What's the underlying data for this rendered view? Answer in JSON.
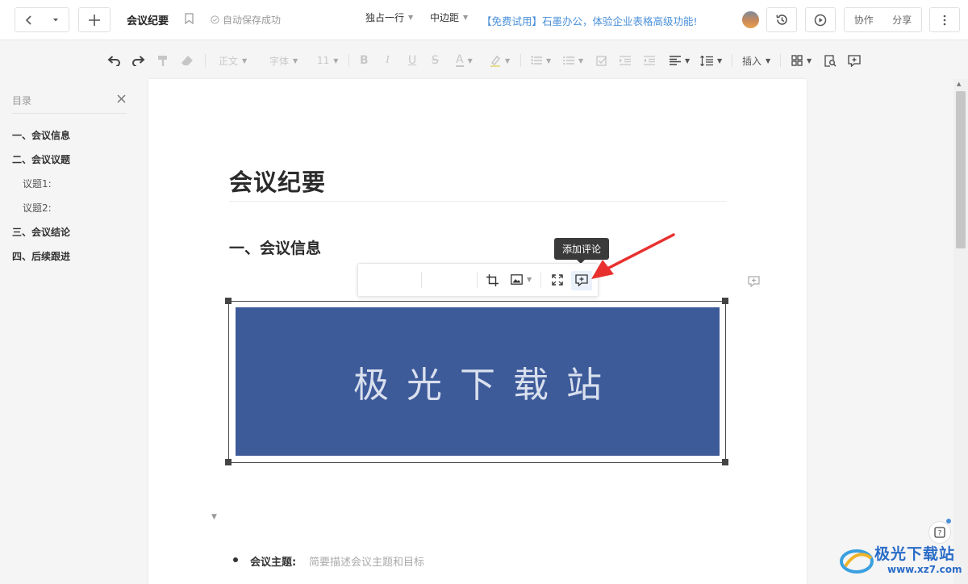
{
  "topbar": {
    "doc_title": "会议纪要",
    "save_status": "自动保存成功",
    "promo": "【免费试用】石墨办公，体验企业表格高级功能!",
    "collab_label": "协作",
    "share_label": "分享"
  },
  "toolbar": {
    "style_label": "正文",
    "font_label": "字体",
    "size_label": "11",
    "insert_label": "插入"
  },
  "outline": {
    "title": "目录",
    "items": [
      {
        "label": "一、会议信息"
      },
      {
        "label": "二、会议议题"
      },
      {
        "label": "议题1:"
      },
      {
        "label": "议题2:"
      },
      {
        "label": "三、会议结论"
      },
      {
        "label": "四、后续跟进"
      }
    ]
  },
  "doc": {
    "h1": "会议纪要",
    "h2": "一、会议信息",
    "image_text": "极光下载站",
    "bullet_label": "会议主题:",
    "bullet_text": "简要描述会议主题和目标"
  },
  "image_toolbar": {
    "layout_label": "独占一行",
    "margin_label": "中边距",
    "tooltip": "添加评论"
  },
  "watermark": {
    "title": "极光下载站",
    "url": "www.xz7.com"
  },
  "colors": {
    "accent": "#4a90d9",
    "banner": "#3d5a99",
    "arrow": "#e8312f"
  }
}
